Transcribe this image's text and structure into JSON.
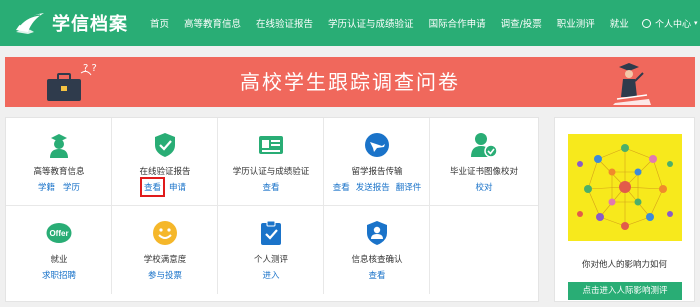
{
  "header": {
    "logo_text": "学信档案",
    "nav": [
      {
        "label": "首页"
      },
      {
        "label": "高等教育信息"
      },
      {
        "label": "在线验证报告"
      },
      {
        "label": "学历认证与成绩验证"
      },
      {
        "label": "国际合作申请"
      },
      {
        "label": "调查/投票"
      },
      {
        "label": "职业测评"
      },
      {
        "label": "就业"
      }
    ],
    "user_menu_label": "个人中心",
    "colors": {
      "bg": "#29ad75",
      "text": "#ffffff"
    }
  },
  "banner": {
    "title": "高校学生跟踪调查问卷",
    "question_marks": "? ?",
    "bg_color": "#f0685c"
  },
  "services": {
    "cells": [
      {
        "title": "高等教育信息",
        "icon": "graduate-icon",
        "links": [
          "学籍",
          "学历"
        ]
      },
      {
        "title": "在线验证报告",
        "icon": "shield-check-icon",
        "links": [
          "查看",
          "申请"
        ],
        "highlighted_link": "查看"
      },
      {
        "title": "学历认证与成绩验证",
        "icon": "id-card-icon",
        "links": [
          "查看"
        ]
      },
      {
        "title": "留学报告传输",
        "icon": "globe-plane-icon",
        "links": [
          "查看",
          "发送报告",
          "翻译件"
        ]
      },
      {
        "title": "毕业证书图像校对",
        "icon": "user-check-icon",
        "links": [
          "校对"
        ]
      },
      {
        "title": "就业",
        "icon": "offer-icon",
        "icon_text": "Offer",
        "links": [
          "求职招聘"
        ]
      },
      {
        "title": "学校满意度",
        "icon": "smile-icon",
        "links": [
          "参与投票"
        ]
      },
      {
        "title": "个人测评",
        "icon": "clipboard-check-icon",
        "links": [
          "进入"
        ]
      },
      {
        "title": "信息核查确认",
        "icon": "user-shield-icon",
        "links": [
          "查看"
        ]
      }
    ],
    "link_color": "#1a73c9",
    "icon_color": "#29ad75"
  },
  "side_ad": {
    "caption": "你对他人的影响力如何",
    "button_label": "点击进入人际影响测评",
    "image_bg": "#f7e91c"
  }
}
